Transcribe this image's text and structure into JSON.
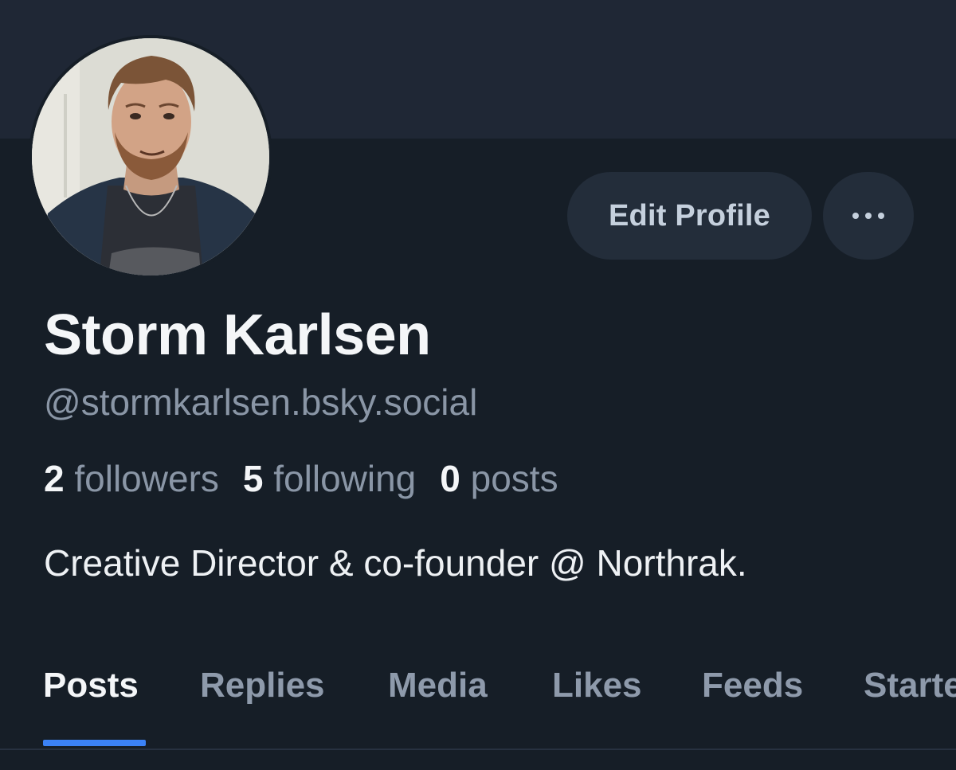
{
  "profile": {
    "display_name": "Storm Karlsen",
    "handle": "@stormkarlsen.bsky.social",
    "bio": "Creative Director & co-founder @ Northrak.",
    "avatar_icon": "profile-photo"
  },
  "actions": {
    "edit_label": "Edit Profile",
    "more_icon": "more-dots-icon"
  },
  "stats": {
    "followers_count": "2",
    "followers_label": "followers",
    "following_count": "5",
    "following_label": "following",
    "posts_count": "0",
    "posts_label": "posts"
  },
  "tabs": [
    {
      "label": "Posts",
      "active": true
    },
    {
      "label": "Replies",
      "active": false
    },
    {
      "label": "Media",
      "active": false
    },
    {
      "label": "Likes",
      "active": false
    },
    {
      "label": "Feeds",
      "active": false
    },
    {
      "label": "Starter Packs",
      "active": false
    }
  ],
  "colors": {
    "accent": "#3b82f6",
    "background": "#161e27",
    "banner": "#1f2735"
  }
}
